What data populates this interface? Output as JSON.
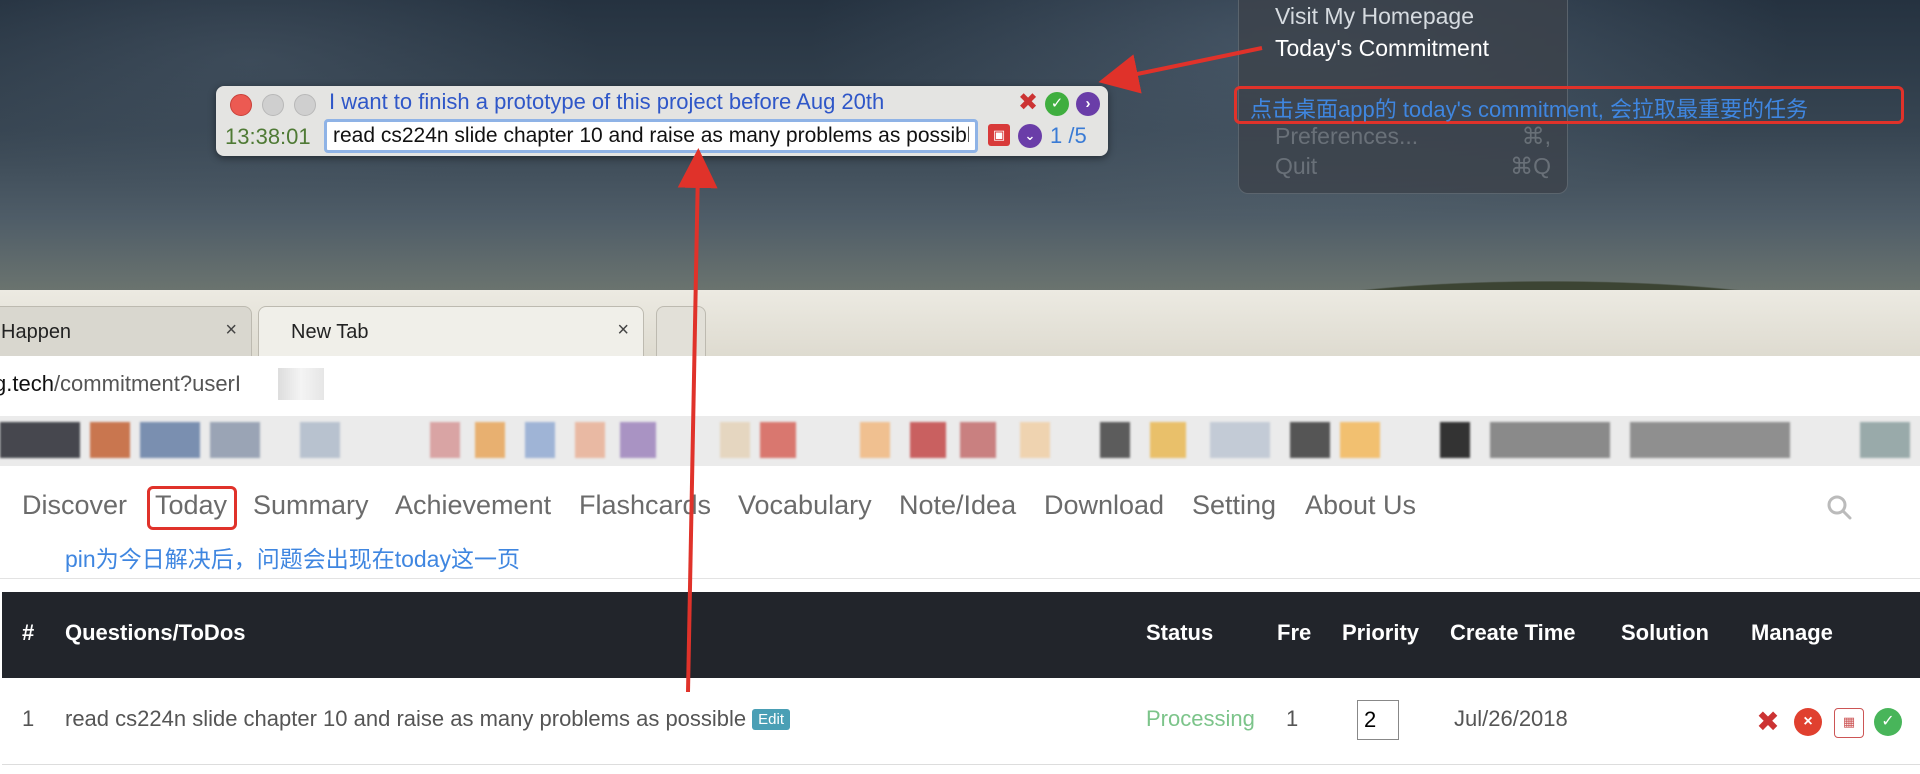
{
  "menu": {
    "items": [
      "Visit My Homepage",
      "Today's Commitment",
      "Preferences...",
      "Quit"
    ],
    "shortcuts": [
      "⌘,",
      "⌘Q"
    ]
  },
  "widget": {
    "goal": "I want to finish a prototype of this project before Aug 20th",
    "time": "13:38:01",
    "task": "read cs224n slide chapter 10 and raise as many problems as possible",
    "counter": "1 /5",
    "icons": [
      "pin-icon",
      "check-icon",
      "next-icon",
      "save-icon",
      "chevron-down-icon"
    ]
  },
  "annotations": {
    "app_note": "点击桌面app的 today's commitment, 会拉取最重要的任务",
    "today_note": "pin为今日解决后，问题会出现在today这一页"
  },
  "browser": {
    "tabs": [
      {
        "label": "Happen",
        "close": "×"
      },
      {
        "label": "New Tab",
        "close": "×"
      }
    ],
    "url_host": "g.tech",
    "url_path": "/commitment?userI"
  },
  "nav": {
    "items": [
      "Discover",
      "Today",
      "Summary",
      "Achievement",
      "Flashcards",
      "Vocabulary",
      "Note/Idea",
      "Download",
      "Setting",
      "About Us"
    ],
    "active": "Today"
  },
  "table": {
    "headers": [
      "#",
      "Questions/ToDos",
      "Status",
      "Fre",
      "Priority",
      "Create Time",
      "Solution",
      "Manage"
    ],
    "rows": [
      {
        "num": "1",
        "question": "read cs224n slide chapter 10 and raise as many problems as possible",
        "edit": "Edit",
        "status": "Processing",
        "fre": "1",
        "priority": "2",
        "create_time": "Jul/26/2018",
        "solution": ""
      }
    ]
  },
  "colors": {
    "annotation_red": "#e0322a",
    "annotation_blue": "#3f86e0",
    "status_green": "#7cc48a",
    "table_header": "#22252b"
  }
}
